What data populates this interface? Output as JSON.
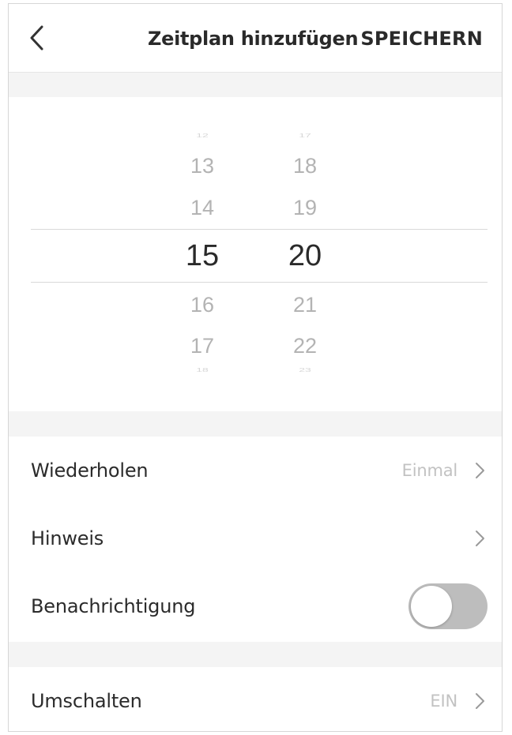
{
  "header": {
    "title": "Zeitplan hinzufügen",
    "save_label": "SPEICHERN",
    "back_icon": "chevron-left-icon"
  },
  "time_picker": {
    "hours": {
      "above_far": "12",
      "above_2": "13",
      "above_1": "14",
      "selected": "15",
      "below_1": "16",
      "below_2": "17",
      "below_far": "18"
    },
    "minutes": {
      "above_far": "17",
      "above_2": "18",
      "above_1": "19",
      "selected": "20",
      "below_1": "21",
      "below_2": "22",
      "below_far": "23"
    }
  },
  "settings": {
    "repeat": {
      "label": "Wiederholen",
      "value": "Einmal"
    },
    "note": {
      "label": "Hinweis"
    },
    "notification": {
      "label": "Benachrichtigung",
      "enabled": false
    },
    "switch": {
      "label": "Umschalten",
      "value": "EIN"
    }
  },
  "colors": {
    "toggle_off_track": "#bdbdbd",
    "section_gap": "#f4f4f4",
    "muted_text": "#c2c2c2"
  }
}
